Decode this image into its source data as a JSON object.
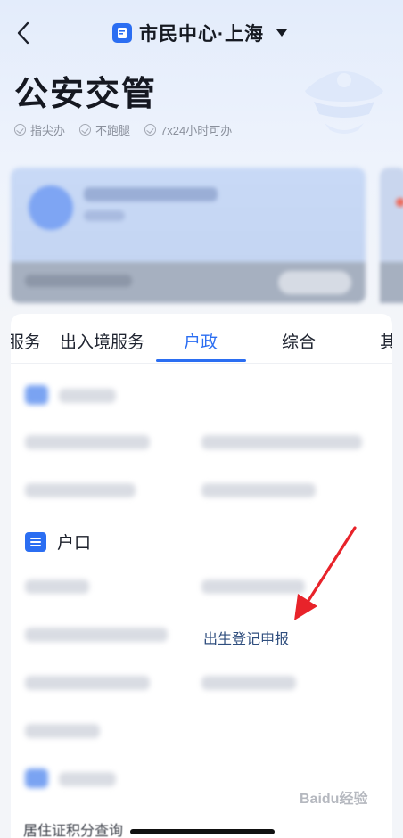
{
  "header": {
    "back_icon": "chevron-left-icon",
    "city_switch_label": "市民中心·上海",
    "city_icon": "document-icon",
    "dropdown_icon": "caret-down-icon"
  },
  "page": {
    "title": "公安交管",
    "hero_icon": "police-hat-icon",
    "features": [
      "指尖办",
      "不跑腿",
      "7x24小时可办"
    ]
  },
  "tabs": {
    "items": [
      "服务",
      "出入境服务",
      "户政",
      "综合",
      "其"
    ],
    "active": "户政"
  },
  "sections": {
    "hukou": {
      "title": "户口",
      "icon": "hukou-icon",
      "visible_item": "出生登记申报"
    }
  },
  "annotation": {
    "arrow_color": "#e8232a"
  },
  "footer": {
    "clipped_text": "居住证积分查询"
  },
  "watermark": {
    "text": "Baidu经验"
  },
  "colors": {
    "accent": "#2b6ef2",
    "title": "#151821",
    "muted": "#8a909c"
  }
}
